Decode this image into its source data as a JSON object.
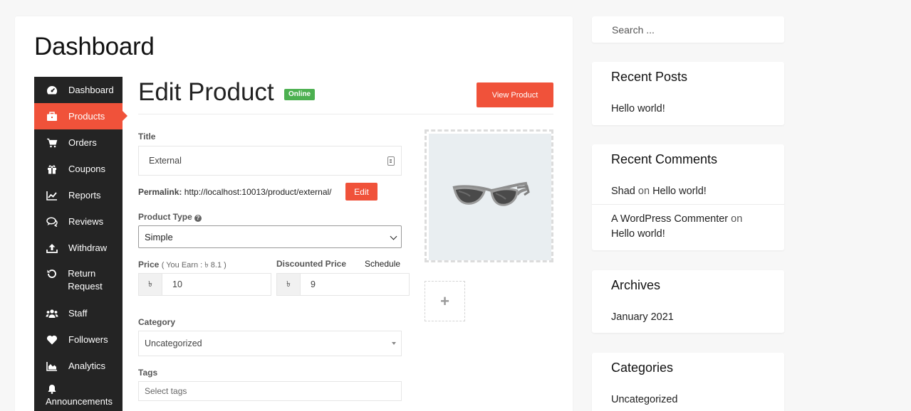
{
  "page": {
    "heading": "Dashboard"
  },
  "sidebar": {
    "items": [
      {
        "label": "Dashboard"
      },
      {
        "label": "Products"
      },
      {
        "label": "Orders"
      },
      {
        "label": "Coupons"
      },
      {
        "label": "Reports"
      },
      {
        "label": "Reviews"
      },
      {
        "label": "Withdraw"
      },
      {
        "label": "Return Request"
      },
      {
        "label": "Staff"
      },
      {
        "label": "Followers"
      },
      {
        "label": "Analytics"
      },
      {
        "label": "Announcements"
      }
    ],
    "active_color": "#f0523a",
    "background": "#242424"
  },
  "product": {
    "title_heading": "Edit Product",
    "status_badge": "Online",
    "view_button": "View Product",
    "title_label": "Title",
    "title_value": "External",
    "permalink_label": "Permalink:",
    "permalink_url": "http://localhost:10013/product/external/",
    "permalink_edit": "Edit",
    "type_label": "Product Type",
    "type_value": "Simple",
    "price_label": "Price",
    "price_earn": "( You Earn : ৳  8.1 )",
    "currency_symbol": "৳",
    "price_value": "10",
    "discount_label": "Discounted Price",
    "schedule_link": "Schedule",
    "discount_value": "9",
    "category_label": "Category",
    "category_value": "Uncategorized",
    "tags_label": "Tags",
    "tags_placeholder": "Select tags",
    "gallery_add": "+"
  },
  "widgets": {
    "search_placeholder": "Search ...",
    "recent_posts": {
      "title": "Recent Posts",
      "items": [
        "Hello world!"
      ]
    },
    "recent_comments": {
      "title": "Recent Comments",
      "items": [
        {
          "author": "Shad",
          "on": "on",
          "post": "Hello world!"
        },
        {
          "author": "A WordPress Commenter",
          "on": "on",
          "post": "Hello world!"
        }
      ]
    },
    "archives": {
      "title": "Archives",
      "items": [
        "January 2021"
      ]
    },
    "categories": {
      "title": "Categories",
      "items": [
        "Uncategorized"
      ]
    }
  },
  "colors": {
    "accent": "#f0523a",
    "online": "#4cb050"
  }
}
